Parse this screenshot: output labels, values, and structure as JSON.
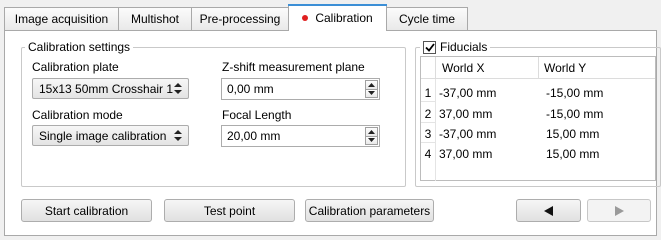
{
  "tabs": [
    {
      "label": "Image acquisition",
      "active": false
    },
    {
      "label": "Multishot",
      "active": false
    },
    {
      "label": "Pre-processing",
      "active": false
    },
    {
      "label": "Calibration",
      "active": true,
      "indicator_color": "#e02020"
    },
    {
      "label": "Cycle time",
      "active": false
    }
  ],
  "calibration_settings": {
    "title": "Calibration settings",
    "plate_label": "Calibration plate",
    "plate_value": "15x13 50mm Crosshair 1",
    "zshift_label": "Z-shift measurement plane",
    "zshift_value": "0,00 mm",
    "mode_label": "Calibration mode",
    "mode_value": "Single image calibration",
    "focal_label": "Focal Length",
    "focal_value": "20,00 mm"
  },
  "fiducials": {
    "title": "Fiducials",
    "checked": true,
    "columns": [
      "World X",
      "World Y"
    ],
    "rows": [
      {
        "index": "1",
        "x": "-37,00 mm",
        "y": "-15,00 mm"
      },
      {
        "index": "2",
        "x": "37,00 mm",
        "y": "-15,00 mm"
      },
      {
        "index": "3",
        "x": "-37,00 mm",
        "y": "15,00 mm"
      },
      {
        "index": "4",
        "x": "37,00 mm",
        "y": "15,00 mm"
      }
    ]
  },
  "buttons": {
    "start_calibration": "Start calibration",
    "test_point": "Test point",
    "calibration_parameters": "Calibration parameters",
    "prev_icon": "left-arrow-icon",
    "next_icon": "right-arrow-icon",
    "next_enabled": false
  },
  "colors": {
    "accent": "#3c8fd6",
    "indicator": "#e02020"
  }
}
